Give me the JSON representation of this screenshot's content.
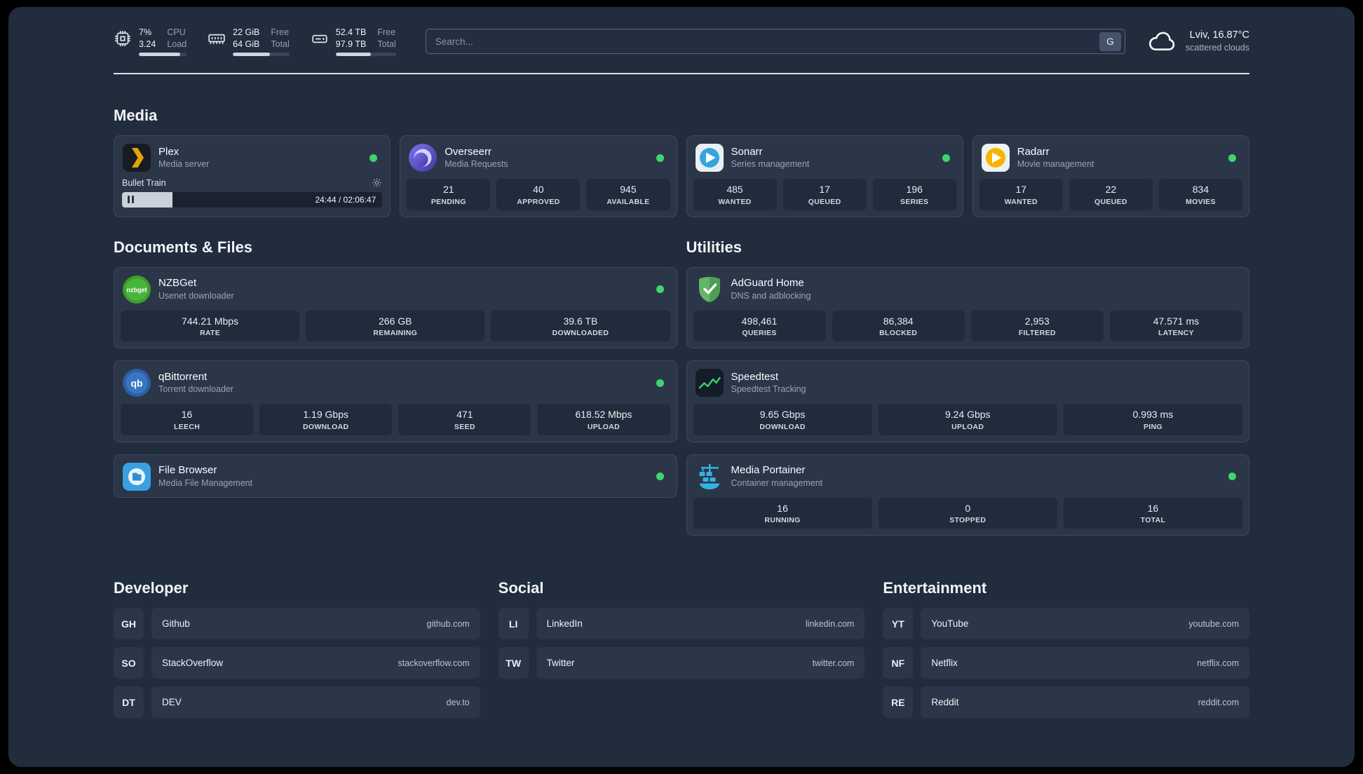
{
  "topbar": {
    "cpu": {
      "value1": "7%",
      "label1": "CPU",
      "value2": "3.24",
      "label2": "Load",
      "bar": "86%"
    },
    "ram": {
      "value1": "22 GiB",
      "label1": "Free",
      "value2": "64 GiB",
      "label2": "Total",
      "bar": "66%"
    },
    "disk": {
      "value1": "52.4 TB",
      "label1": "Free",
      "value2": "97.9 TB",
      "label2": "Total",
      "bar": "58%"
    },
    "search": {
      "placeholder": "Search...",
      "button_label": "G"
    },
    "weather": {
      "location": "Lviv, 16.87°C",
      "condition": "scattered clouds"
    }
  },
  "sections": {
    "media": {
      "title": "Media",
      "apps": [
        {
          "name": "Plex",
          "subtitle": "Media server",
          "online": true,
          "player": {
            "title": "Bullet Train",
            "time": "24:44 / 02:06:47",
            "progress": "19.5%"
          }
        },
        {
          "name": "Overseerr",
          "subtitle": "Media Requests",
          "online": true,
          "stats": [
            {
              "value": "21",
              "label": "PENDING"
            },
            {
              "value": "40",
              "label": "APPROVED"
            },
            {
              "value": "945",
              "label": "AVAILABLE"
            }
          ]
        },
        {
          "name": "Sonarr",
          "subtitle": "Series management",
          "online": true,
          "stats": [
            {
              "value": "485",
              "label": "WANTED"
            },
            {
              "value": "17",
              "label": "QUEUED"
            },
            {
              "value": "196",
              "label": "SERIES"
            }
          ]
        },
        {
          "name": "Radarr",
          "subtitle": "Movie management",
          "online": true,
          "stats": [
            {
              "value": "17",
              "label": "WANTED"
            },
            {
              "value": "22",
              "label": "QUEUED"
            },
            {
              "value": "834",
              "label": "MOVIES"
            }
          ]
        }
      ]
    },
    "documents": {
      "title": "Documents & Files",
      "apps": [
        {
          "name": "NZBGet",
          "subtitle": "Usenet downloader",
          "online": true,
          "stats": [
            {
              "value": "744.21 Mbps",
              "label": "RATE"
            },
            {
              "value": "266 GB",
              "label": "REMAINING"
            },
            {
              "value": "39.6 TB",
              "label": "DOWNLOADED"
            }
          ]
        },
        {
          "name": "qBittorrent",
          "subtitle": "Torrent downloader",
          "online": true,
          "stats": [
            {
              "value": "16",
              "label": "LEECH"
            },
            {
              "value": "1.19 Gbps",
              "label": "DOWNLOAD"
            },
            {
              "value": "471",
              "label": "SEED"
            },
            {
              "value": "618.52 Mbps",
              "label": "UPLOAD"
            }
          ]
        },
        {
          "name": "File Browser",
          "subtitle": "Media File Management",
          "online": true,
          "stats": []
        }
      ]
    },
    "utilities": {
      "title": "Utilities",
      "apps": [
        {
          "name": "AdGuard Home",
          "subtitle": "DNS and adblocking",
          "online": false,
          "stats": [
            {
              "value": "498,461",
              "label": "QUERIES"
            },
            {
              "value": "86,384",
              "label": "BLOCKED"
            },
            {
              "value": "2,953",
              "label": "FILTERED"
            },
            {
              "value": "47.571 ms",
              "label": "LATENCY"
            }
          ]
        },
        {
          "name": "Speedtest",
          "subtitle": "Speedtest Tracking",
          "online": false,
          "stats": [
            {
              "value": "9.65 Gbps",
              "label": "DOWNLOAD"
            },
            {
              "value": "9.24 Gbps",
              "label": "UPLOAD"
            },
            {
              "value": "0.993 ms",
              "label": "PING"
            }
          ]
        },
        {
          "name": "Media Portainer",
          "subtitle": "Container management",
          "online": true,
          "stats": [
            {
              "value": "16",
              "label": "RUNNING"
            },
            {
              "value": "0",
              "label": "STOPPED"
            },
            {
              "value": "16",
              "label": "TOTAL"
            }
          ]
        }
      ]
    },
    "developer": {
      "title": "Developer",
      "bookmarks": [
        {
          "abbr": "GH",
          "name": "Github",
          "url": "github.com"
        },
        {
          "abbr": "SO",
          "name": "StackOverflow",
          "url": "stackoverflow.com"
        },
        {
          "abbr": "DT",
          "name": "DEV",
          "url": "dev.to"
        }
      ]
    },
    "social": {
      "title": "Social",
      "bookmarks": [
        {
          "abbr": "LI",
          "name": "LinkedIn",
          "url": "linkedin.com"
        },
        {
          "abbr": "TW",
          "name": "Twitter",
          "url": "twitter.com"
        }
      ]
    },
    "entertainment": {
      "title": "Entertainment",
      "bookmarks": [
        {
          "abbr": "YT",
          "name": "YouTube",
          "url": "youtube.com"
        },
        {
          "abbr": "NF",
          "name": "Netflix",
          "url": "netflix.com"
        },
        {
          "abbr": "RE",
          "name": "Reddit",
          "url": "reddit.com"
        }
      ]
    }
  },
  "colors": {
    "page_bg": "#212c3d",
    "card_bg": "#2b3649",
    "tile_bg": "#212b3c",
    "status_online": "#3fd46c",
    "plex_accent": "#e5a00d",
    "divider": "#dde2e8"
  }
}
